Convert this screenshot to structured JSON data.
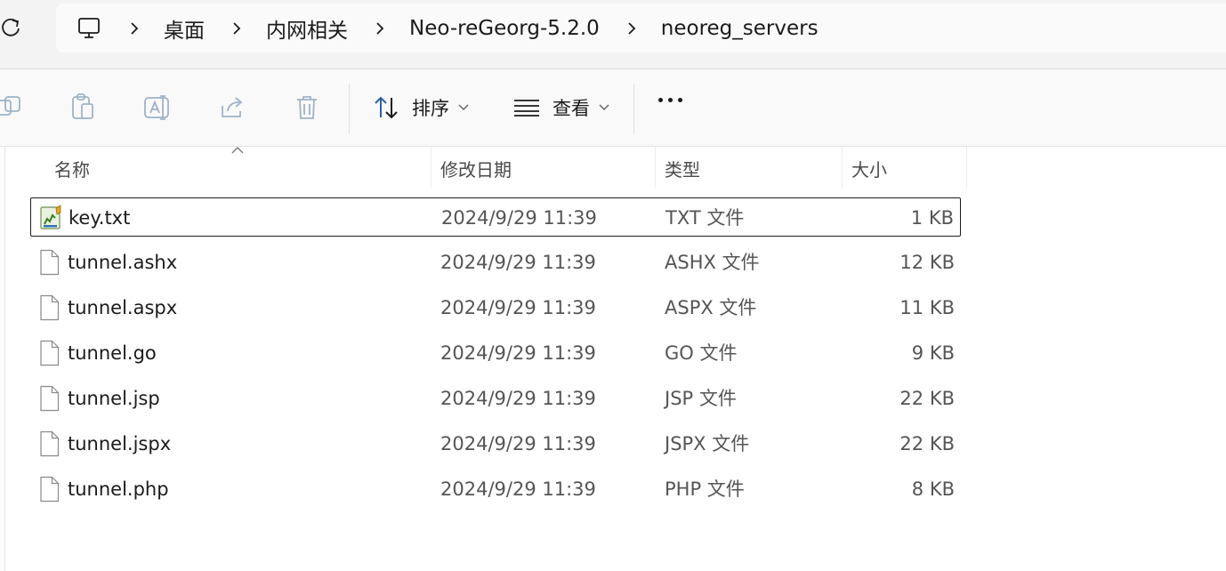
{
  "breadcrumb": [
    "桌面",
    "内网相关",
    "Neo-reGeorg-5.2.0",
    "neoreg_servers"
  ],
  "toolbar": {
    "icons": [
      "copy-icon",
      "paste-icon",
      "rename-icon",
      "share-icon",
      "delete-icon"
    ],
    "sort_label": "排序",
    "view_label": "查看"
  },
  "columns": {
    "name": "名称",
    "modified": "修改日期",
    "type": "类型",
    "size": "大小"
  },
  "files": [
    {
      "name": "key.txt",
      "modified": "2024/9/29 11:39",
      "type": "TXT 文件",
      "size": "1 KB",
      "icon": "text-file-icon"
    },
    {
      "name": "tunnel.ashx",
      "modified": "2024/9/29 11:39",
      "type": "ASHX 文件",
      "size": "12 KB",
      "icon": "generic-file-icon"
    },
    {
      "name": "tunnel.aspx",
      "modified": "2024/9/29 11:39",
      "type": "ASPX 文件",
      "size": "11 KB",
      "icon": "generic-file-icon"
    },
    {
      "name": "tunnel.go",
      "modified": "2024/9/29 11:39",
      "type": "GO 文件",
      "size": "9 KB",
      "icon": "generic-file-icon"
    },
    {
      "name": "tunnel.jsp",
      "modified": "2024/9/29 11:39",
      "type": "JSP 文件",
      "size": "22 KB",
      "icon": "generic-file-icon"
    },
    {
      "name": "tunnel.jspx",
      "modified": "2024/9/29 11:39",
      "type": "JSPX 文件",
      "size": "22 KB",
      "icon": "generic-file-icon"
    },
    {
      "name": "tunnel.php",
      "modified": "2024/9/29 11:39",
      "type": "PHP 文件",
      "size": "8 KB",
      "icon": "generic-file-icon"
    }
  ],
  "selected_file": "key.txt"
}
